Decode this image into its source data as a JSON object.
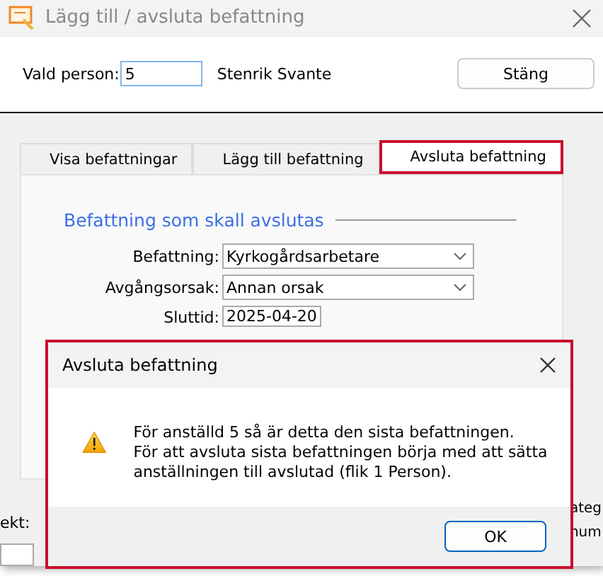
{
  "window": {
    "title": "Lägg till / avsluta  befattning"
  },
  "person": {
    "label": "Vald person:",
    "value": "5",
    "name": "Stenrik Svante"
  },
  "close_button": "Stäng",
  "tabs": [
    {
      "label": "Visa befattningar",
      "selected": false
    },
    {
      "label": "Lägg till befattning",
      "selected": false
    },
    {
      "label": "Avsluta befattning",
      "selected": true
    }
  ],
  "section": {
    "title": "Befattning som skall avslutas"
  },
  "fields": [
    {
      "label": "Befattning:",
      "value": "Kyrkogårdsarbetare",
      "kind": "dropdown"
    },
    {
      "label": "Avgångsorsak:",
      "value": "Annan orsak",
      "kind": "dropdown"
    },
    {
      "label": "Sluttid:",
      "value": "2025-04-20",
      "kind": "text"
    }
  ],
  "background_fragments": {
    "left": [
      "ekt:"
    ],
    "right": [
      "ateg",
      "num"
    ]
  },
  "dialog": {
    "title": "Avsluta befattning",
    "message": "För anställd 5 så är detta den sista befattningen.\nFör att avsluta sista befattningen börja med att sätta anställningen till avslutad (flik 1 Person).",
    "button": "OK"
  }
}
